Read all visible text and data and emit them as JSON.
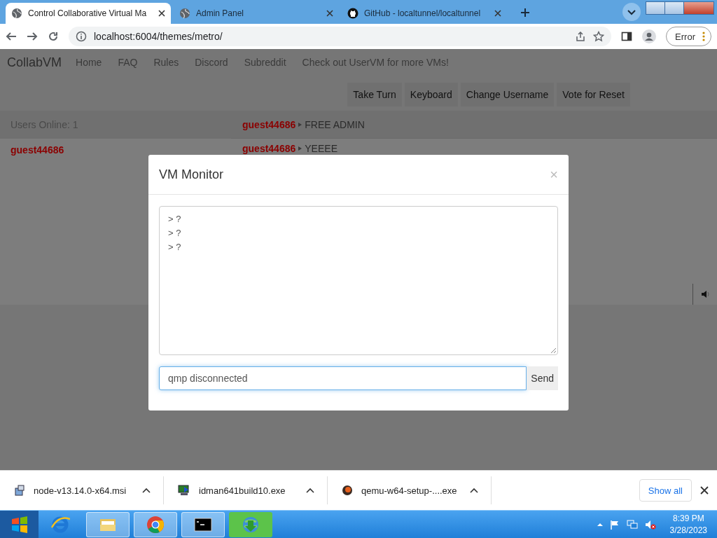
{
  "browser": {
    "tabs": [
      {
        "title": "Control Collaborative Virtual Ma",
        "kind": "globe",
        "selected": true
      },
      {
        "title": "Admin Panel",
        "kind": "globe",
        "selected": false
      },
      {
        "title": "GitHub - localtunnel/localtunnel",
        "kind": "github",
        "selected": false
      }
    ],
    "address": "localhost:6004/themes/metro/",
    "profile_button": "Error"
  },
  "page": {
    "brand": "CollabVM",
    "nav_links": [
      "Home",
      "FAQ",
      "Rules",
      "Discord",
      "Subreddit"
    ],
    "notice": "Check out UserVM for more VMs!",
    "actions": [
      "Take Turn",
      "Keyboard",
      "Change Username",
      "Vote for Reset"
    ],
    "users_online": "Users Online: 1",
    "users": [
      "guest44686"
    ],
    "chat": [
      {
        "user": "guest44686",
        "message": "FREE ADMIN"
      },
      {
        "user": "guest44686",
        "message": "YEEEE"
      }
    ]
  },
  "modal": {
    "title": "VM Monitor",
    "close": "×",
    "output": [
      "> ?",
      "> ?",
      "> ?"
    ],
    "command": "qmp disconnected",
    "send": "Send"
  },
  "downloads": {
    "items": [
      {
        "name": "node-v13.14.0-x64.msi",
        "kind": "package"
      },
      {
        "name": "idman641build10.exe",
        "kind": "monitor"
      },
      {
        "name": "qemu-w64-setup-....exe",
        "kind": "orb"
      }
    ],
    "show_all": "Show all"
  },
  "taskbar": {
    "time": "8:39 PM",
    "date": "3/28/2023"
  }
}
